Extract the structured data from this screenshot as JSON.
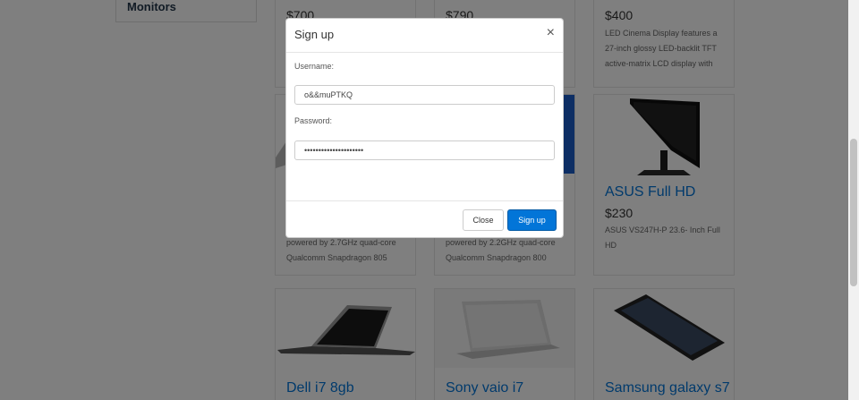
{
  "sidebar": {
    "items": [
      {
        "label": "Monitors"
      }
    ]
  },
  "products": {
    "row1": [
      {
        "price": "$700"
      },
      {
        "price": "$790"
      },
      {
        "price": "$400",
        "desc": "LED Cinema Display features a 27-inch glossy LED-backlit TFT active-matrix LCD display with"
      }
    ],
    "row2": [
      {
        "desc": "powered by 2.7GHz quad-core Qualcomm Snapdragon 805"
      },
      {
        "desc": "powered by 2.2GHz quad-core Qualcomm Snapdragon 800"
      },
      {
        "title": "ASUS Full HD",
        "price": "$230",
        "desc": "ASUS VS247H-P 23.6- Inch Full HD"
      }
    ],
    "row3": [
      {
        "title": "Dell i7 8gb"
      },
      {
        "title": "Sony vaio i7"
      },
      {
        "title": "Samsung galaxy s7"
      }
    ]
  },
  "modal": {
    "title": "Sign up",
    "close_symbol": "×",
    "username_label": "Username:",
    "username_value": "o&&muPTKQ",
    "password_label": "Password:",
    "password_value": "•••••••••••••••••••••",
    "close_button": "Close",
    "signup_button": "Sign up"
  },
  "icons": {
    "close": "close-icon"
  },
  "colors": {
    "accent": "#0275d8",
    "overlay": "rgba(0,0,0,0.5)"
  }
}
